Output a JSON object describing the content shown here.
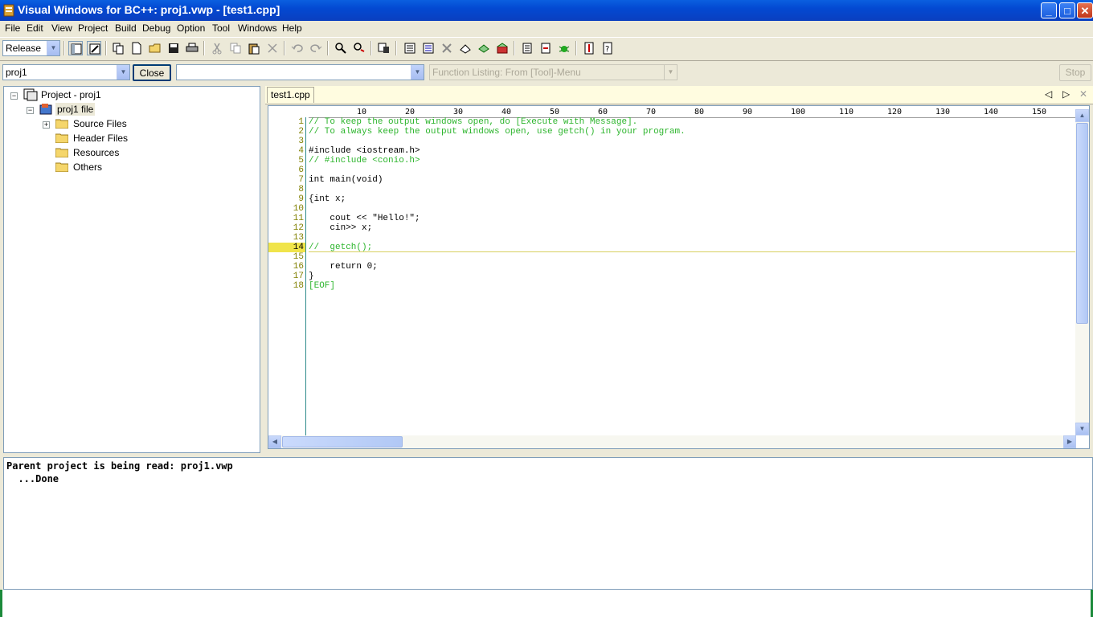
{
  "window": {
    "title": "Visual Windows for BC++: proj1.vwp - [test1.cpp]",
    "controls": {
      "minimize": "_",
      "maximize": "□",
      "close": "✕"
    }
  },
  "menu": [
    "File",
    "Edit",
    "View",
    "Project",
    "Build",
    "Debug",
    "Option",
    "Tool",
    "Windows",
    "Help"
  ],
  "toolbar": {
    "build_mode": "Release",
    "icons": [
      "panel-toggle-icon",
      "output-toggle-icon",
      "copy-project-icon",
      "new-file-icon",
      "open-icon",
      "save-icon",
      "print-icon",
      "cut-icon",
      "copy-icon",
      "paste-icon",
      "delete-icon",
      "undo-icon",
      "redo-icon",
      "find-icon",
      "replace-icon",
      "find-in-files-icon",
      "compile-icon",
      "build-icon",
      "clear-icon",
      "link-icon",
      "rebuild-icon",
      "execute-icon",
      "execute-message-icon",
      "debug-icon",
      "help-icon",
      "help-index-icon"
    ]
  },
  "toolbar2": {
    "project_combo": "proj1",
    "close_label": "Close",
    "file_combo": "",
    "function_listing": "Function Listing: From [Tool]-Menu",
    "stop_label": "Stop"
  },
  "project_tree": {
    "root": "Project - proj1",
    "file": "proj1 file",
    "folders": [
      "Source Files",
      "Header Files",
      "Resources",
      "Others"
    ]
  },
  "editor": {
    "tab": "test1.cpp",
    "ruler": [
      "10",
      "20",
      "30",
      "40",
      "50",
      "60",
      "70",
      "80",
      "90",
      "100",
      "110",
      "120",
      "130",
      "140",
      "150"
    ],
    "current_line": "14",
    "lines": [
      {
        "n": "1",
        "text": "// To keep the output windows open, do [Execute with Message].",
        "type": "comment"
      },
      {
        "n": "2",
        "text": "// To always keep the output windows open, use getch() in your program.",
        "type": "comment"
      },
      {
        "n": "3",
        "text": "",
        "type": "code"
      },
      {
        "n": "4",
        "text": "#include <iostream.h>",
        "type": "code"
      },
      {
        "n": "5",
        "text": "// #include <conio.h>",
        "type": "comment"
      },
      {
        "n": "6",
        "text": "",
        "type": "code"
      },
      {
        "n": "7",
        "text": "int main(void)",
        "type": "code"
      },
      {
        "n": "8",
        "text": "",
        "type": "code"
      },
      {
        "n": "9",
        "text": "{int x;",
        "type": "code"
      },
      {
        "n": "10",
        "text": "",
        "type": "code"
      },
      {
        "n": "11",
        "text": "    cout << \"Hello!\";",
        "type": "code"
      },
      {
        "n": "12",
        "text": "    cin>> x;",
        "type": "code"
      },
      {
        "n": "13",
        "text": "",
        "type": "code"
      },
      {
        "n": "14",
        "text": "//  getch();",
        "type": "comment"
      },
      {
        "n": "15",
        "text": "",
        "type": "code"
      },
      {
        "n": "16",
        "text": "    return 0;",
        "type": "code"
      },
      {
        "n": "17",
        "text": "}",
        "type": "code"
      },
      {
        "n": "18",
        "text": "[EOF]",
        "type": "comment"
      }
    ]
  },
  "output": {
    "lines": [
      "Parent project is being read: proj1.vwp",
      "  ...Done"
    ]
  }
}
